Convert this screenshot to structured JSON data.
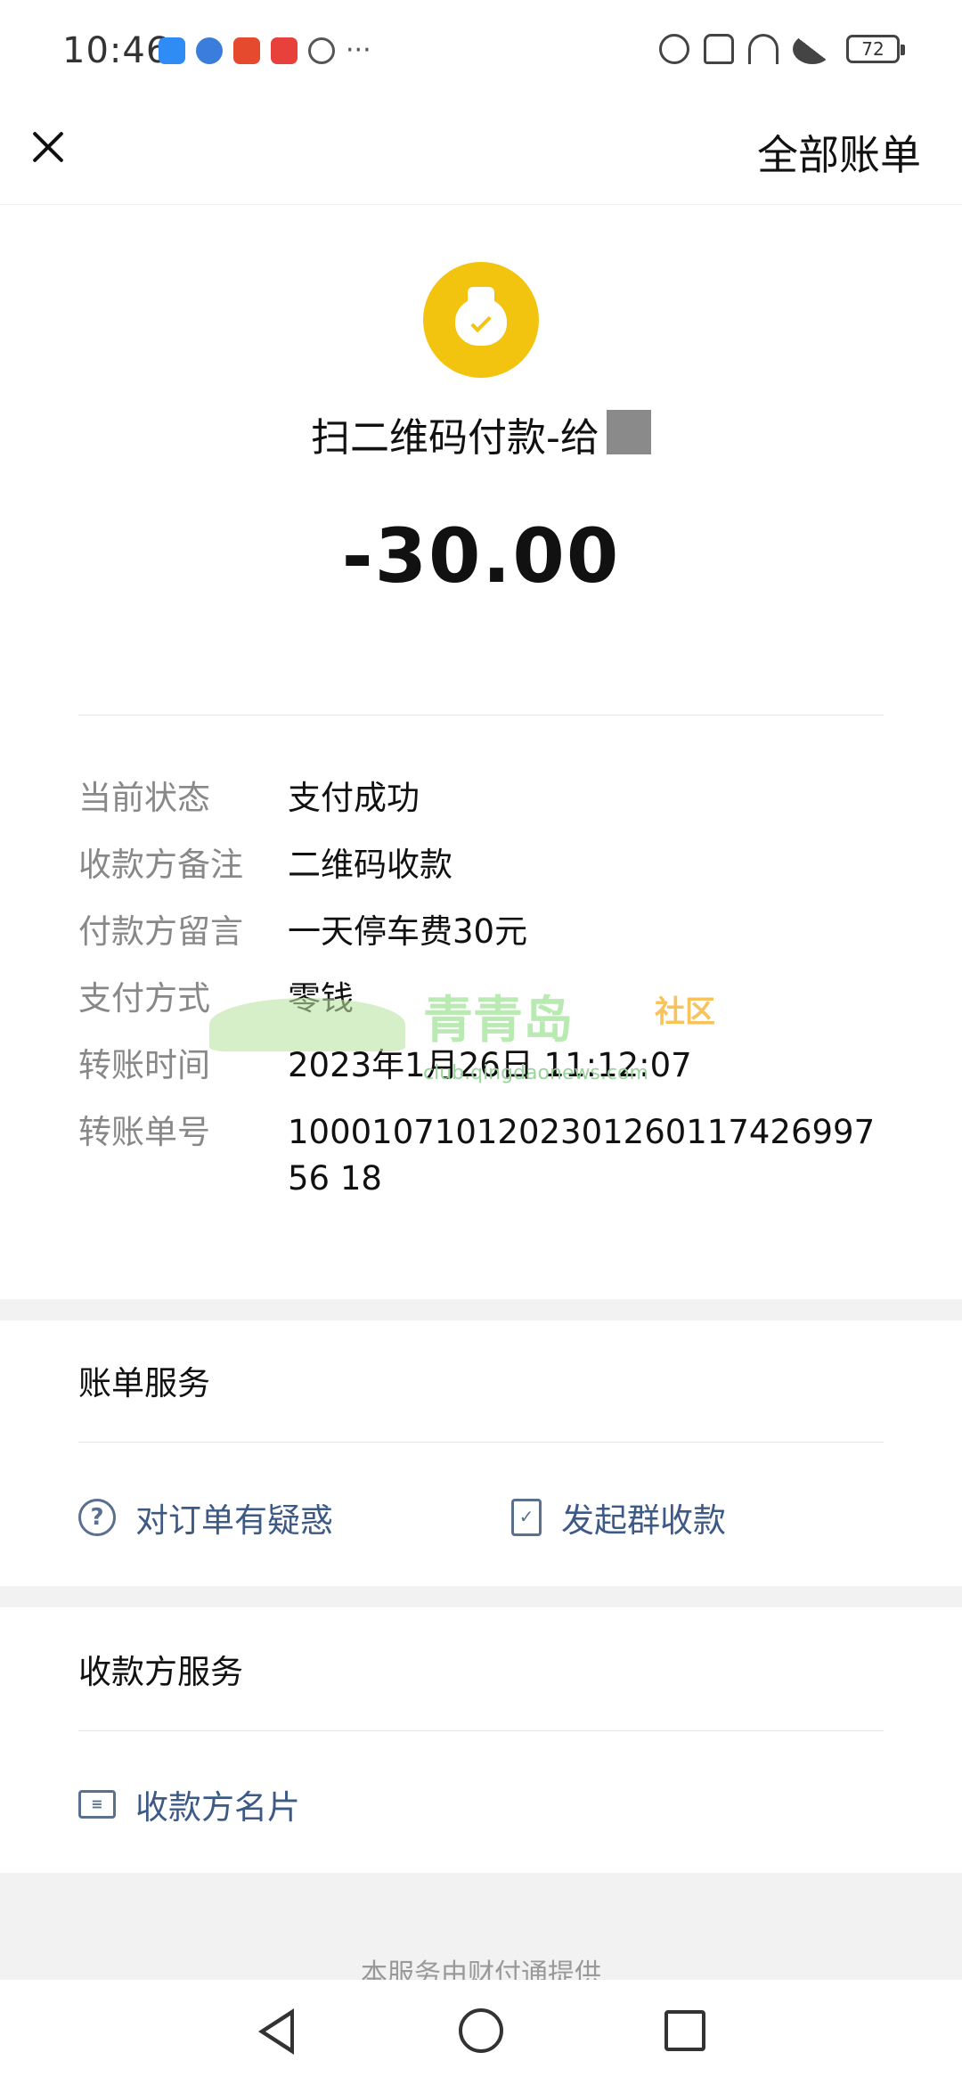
{
  "status_bar": {
    "time": "10:46",
    "notification_icons": [
      "cloud-icon",
      "globe-icon",
      "wallet-icon",
      "shop-icon",
      "browser-icon"
    ],
    "more": "···",
    "battery": "72"
  },
  "nav": {
    "right_label": "全部账单"
  },
  "header": {
    "icon": "money-bag-icon",
    "title": "扫二维码付款-给",
    "amount": "-30.00"
  },
  "details": [
    {
      "label": "当前状态",
      "value": "支付成功"
    },
    {
      "label": "收款方备注",
      "value": "二维码收款"
    },
    {
      "label": "付款方留言",
      "value": "一天停车费30元"
    },
    {
      "label": "支付方式",
      "value": "零钱"
    },
    {
      "label": "转账时间",
      "value": "2023年1月26日 11:12:07"
    },
    {
      "label": "转账单号",
      "value": "100010710120230126011742699756 18"
    }
  ],
  "watermark": {
    "text": "青青岛",
    "sub": "社区",
    "url": "club.qingdaonews.com"
  },
  "bill_service": {
    "title": "账单服务",
    "actions": [
      {
        "icon": "question-icon",
        "label": "对订单有疑惑"
      },
      {
        "icon": "document-icon",
        "label": "发起群收款"
      }
    ]
  },
  "payee_service": {
    "title": "收款方服务",
    "actions": [
      {
        "icon": "business-card-icon",
        "label": "收款方名片"
      }
    ]
  },
  "footer": "本服务由财付通提供",
  "colors": {
    "accent_yellow": "#f2c40f",
    "link_blue": "#3d5a86",
    "label_gray": "#888888",
    "band_gray": "#f2f2f2"
  }
}
